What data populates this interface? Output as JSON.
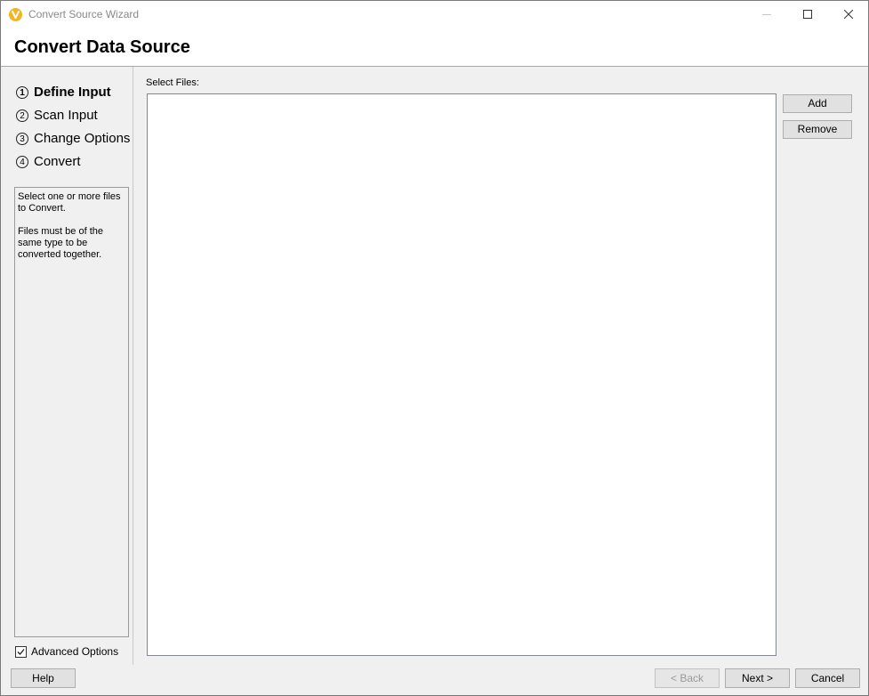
{
  "window": {
    "title": "Convert Source Wizard",
    "brand_color": "#f4b521"
  },
  "header": {
    "title": "Convert Data Source"
  },
  "steps": [
    {
      "number": "1",
      "label": "Define Input",
      "active": true
    },
    {
      "number": "2",
      "label": "Scan Input",
      "active": false
    },
    {
      "number": "3",
      "label": "Change Options",
      "active": false
    },
    {
      "number": "4",
      "label": "Convert",
      "active": false
    }
  ],
  "help_text": {
    "line1": "Select one or more files to Convert.",
    "line2": "Files must be of the same type to be converted together."
  },
  "advanced_options": {
    "label": "Advanced Options",
    "checked": true
  },
  "main": {
    "select_files_label": "Select Files:",
    "files": [],
    "add_label": "Add",
    "remove_label": "Remove"
  },
  "footer": {
    "help_label": "Help",
    "back_label": "< Back",
    "next_label": "Next >",
    "cancel_label": "Cancel"
  }
}
